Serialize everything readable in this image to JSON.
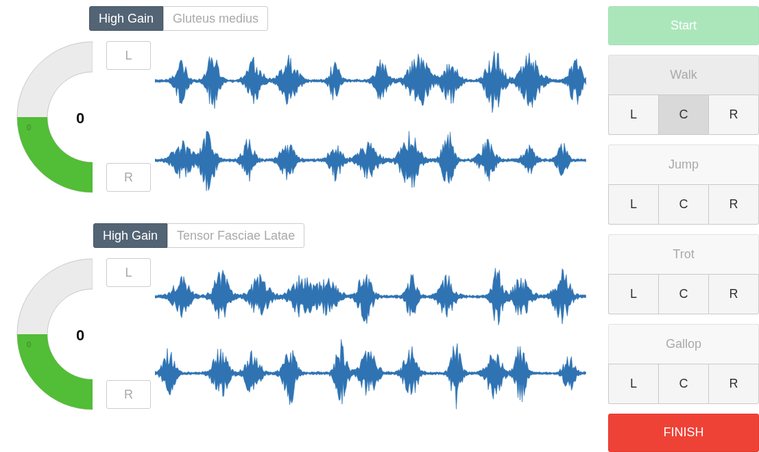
{
  "channels": [
    {
      "tabs": [
        {
          "label": "High Gain",
          "selected": true
        },
        {
          "label": "Gluteus medius",
          "selected": false
        }
      ],
      "gauge": {
        "value": "0",
        "scale_label": "0",
        "level": 0.5
      },
      "side_buttons": [
        "L",
        "R"
      ]
    },
    {
      "tabs": [
        {
          "label": "High Gain",
          "selected": true
        },
        {
          "label": "Tensor Fasciae Latae",
          "selected": false
        }
      ],
      "gauge": {
        "value": "0",
        "scale_label": "0",
        "level": 0.5
      },
      "side_buttons": [
        "L",
        "R"
      ]
    }
  ],
  "controls": {
    "start": {
      "label": "Start",
      "disabled": true
    },
    "gaits": [
      {
        "name": "Walk",
        "selected": true,
        "sides": [
          {
            "label": "L",
            "selected": false
          },
          {
            "label": "C",
            "selected": true
          },
          {
            "label": "R",
            "selected": false
          }
        ]
      },
      {
        "name": "Jump",
        "selected": false,
        "sides": [
          {
            "label": "L",
            "selected": false
          },
          {
            "label": "C",
            "selected": false
          },
          {
            "label": "R",
            "selected": false
          }
        ]
      },
      {
        "name": "Trot",
        "selected": false,
        "sides": [
          {
            "label": "L",
            "selected": false
          },
          {
            "label": "C",
            "selected": false
          },
          {
            "label": "R",
            "selected": false
          }
        ]
      },
      {
        "name": "Gallop",
        "selected": false,
        "sides": [
          {
            "label": "L",
            "selected": false
          },
          {
            "label": "C",
            "selected": false
          },
          {
            "label": "R",
            "selected": false
          }
        ]
      }
    ],
    "finish": "FINISH"
  }
}
